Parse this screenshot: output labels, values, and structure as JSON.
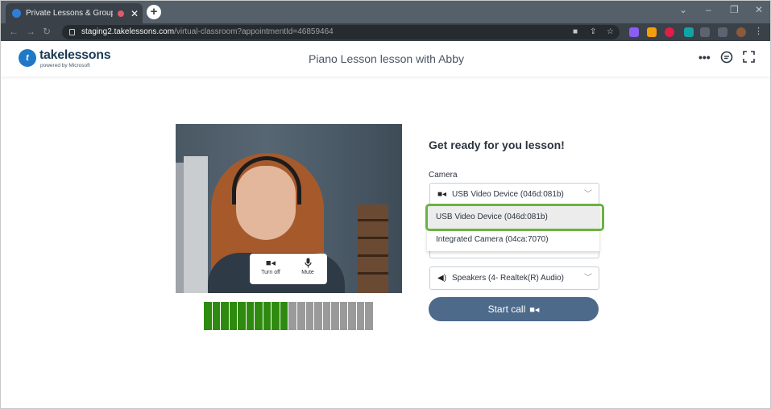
{
  "browser": {
    "tab_title": "Private Lessons & Group Cla",
    "tab_close": "✕",
    "new_tab": "+",
    "url_host": "staging2.takelessons.com",
    "url_path": "/virtual-classroom?appointmentId=46859464",
    "window_controls": [
      "⌄",
      "–",
      "❐",
      "✕"
    ]
  },
  "header": {
    "logo_mark": "t",
    "logo_text": "takelessons",
    "logo_sub": "powered by Microsoft",
    "title": "Piano Lesson lesson with Abby",
    "icons": [
      "more-icon",
      "chat-icon",
      "fullscreen-icon"
    ]
  },
  "video": {
    "turn_off_label": "Turn off",
    "mute_label": "Mute"
  },
  "meter": {
    "total_segments": 20,
    "active_segments": 10,
    "active_color": "#2e8b0f",
    "inactive_color": "#9a9a9a"
  },
  "panel": {
    "title": "Get ready for you lesson!",
    "camera_label": "Camera",
    "camera_selected": "USB Video Device (046d:081b)",
    "camera_options": [
      "USB Video Device (046d:081b)",
      "Integrated Camera (04ca:7070)"
    ],
    "speaker_selected": "Speakers (4- Realtek(R) Audio)",
    "start_label": "Start call"
  },
  "colors": {
    "highlight": "#6cb142",
    "start_button": "#4d6a8b"
  }
}
